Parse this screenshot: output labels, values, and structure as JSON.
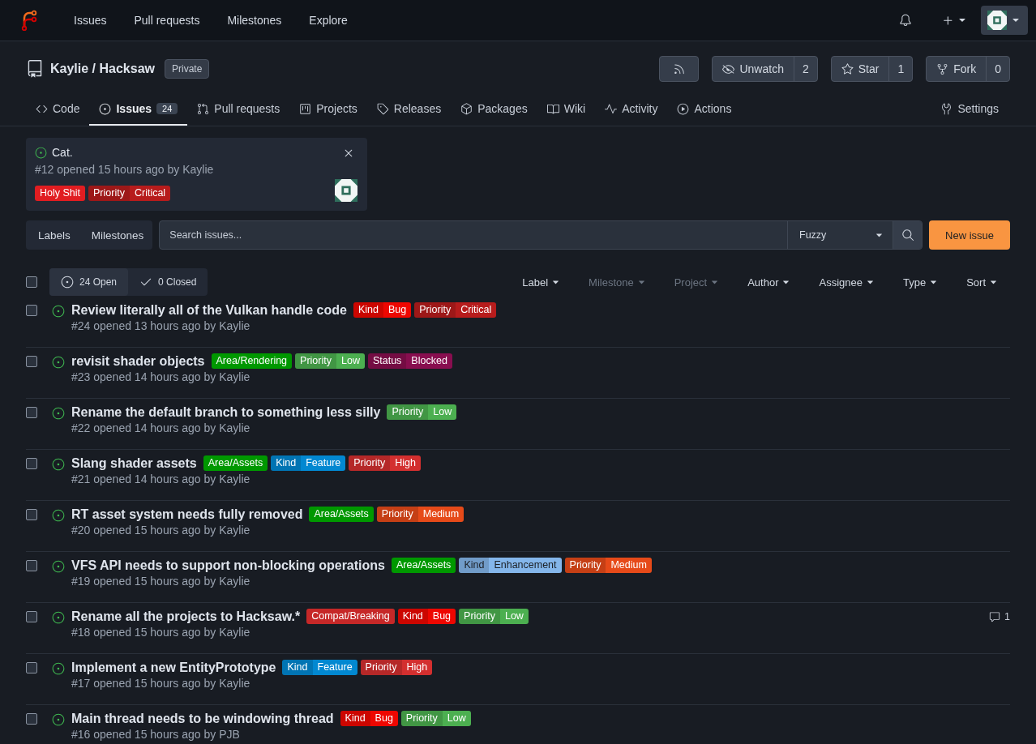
{
  "nav": {
    "links": [
      "Issues",
      "Pull requests",
      "Milestones",
      "Explore"
    ]
  },
  "repo": {
    "owner": "Kaylie",
    "separator": "/",
    "name": "Hacksaw",
    "visibility": "Private",
    "actions": [
      {
        "kind": "rss"
      },
      {
        "kind": "watch",
        "label": "Unwatch",
        "count": "2"
      },
      {
        "kind": "star",
        "label": "Star",
        "count": "1"
      },
      {
        "kind": "fork",
        "label": "Fork",
        "count": "0"
      }
    ]
  },
  "tabs": [
    {
      "label": "Code",
      "selected": false
    },
    {
      "label": "Issues",
      "count": "24",
      "selected": true
    },
    {
      "label": "Pull requests",
      "selected": false
    },
    {
      "label": "Projects",
      "selected": false
    },
    {
      "label": "Releases",
      "selected": false
    },
    {
      "label": "Packages",
      "selected": false
    },
    {
      "label": "Wiki",
      "selected": false
    },
    {
      "label": "Activity",
      "selected": false
    },
    {
      "label": "Actions",
      "selected": false
    }
  ],
  "settings_tab": {
    "label": "Settings",
    "selected": false
  },
  "pinned": {
    "title": "Cat.",
    "meta": "#12 opened 15 hours ago by Kaylie",
    "labels": [
      {
        "kind": "plain",
        "name": "Holy Shit",
        "color": "#e11d21"
      },
      {
        "kind": "scoped",
        "scope": "Priority",
        "name": "Critical",
        "color": "#b71c1c"
      }
    ]
  },
  "toolbar": {
    "links": [
      "Labels",
      "Milestones"
    ],
    "search_placeholder": "Search issues...",
    "mode": "Fuzzy",
    "new_button": "New issue"
  },
  "select_all": {
    "checked": false
  },
  "state_tabs": [
    {
      "label": "24 Open",
      "selected": true
    },
    {
      "label": "0 Closed",
      "selected": false
    }
  ],
  "filters": [
    {
      "label": "Label",
      "disabled": false
    },
    {
      "label": "Milestone",
      "disabled": true
    },
    {
      "label": "Project",
      "disabled": true
    },
    {
      "label": "Author",
      "disabled": false
    },
    {
      "label": "Assignee",
      "disabled": false
    },
    {
      "label": "Type",
      "disabled": false
    },
    {
      "label": "Sort",
      "disabled": false
    }
  ],
  "issues": [
    {
      "title": "Review literally all of the Vulkan handle code",
      "meta": "#24 opened 13 hours ago by Kaylie",
      "checked": false,
      "labels": [
        {
          "kind": "scoped",
          "scope": "Kind",
          "name": "Bug",
          "color": "#ee0701"
        },
        {
          "kind": "scoped",
          "scope": "Priority",
          "name": "Critical",
          "color": "#b71c1c"
        }
      ]
    },
    {
      "title": "revisit shader objects",
      "meta": "#23 opened 14 hours ago by Kaylie",
      "checked": false,
      "labels": [
        {
          "kind": "plain",
          "name": "Area/Rendering",
          "color": "#009800"
        },
        {
          "kind": "scoped",
          "scope": "Priority",
          "name": "Low",
          "color": "#4caf50"
        },
        {
          "kind": "scoped",
          "scope": "Status",
          "name": "Blocked",
          "color": "#880e4f"
        }
      ]
    },
    {
      "title": "Rename the default branch to something less silly",
      "meta": "#22 opened 14 hours ago by Kaylie",
      "checked": false,
      "labels": [
        {
          "kind": "scoped",
          "scope": "Priority",
          "name": "Low",
          "color": "#4caf50"
        }
      ]
    },
    {
      "title": "Slang shader assets",
      "meta": "#21 opened 14 hours ago by Kaylie",
      "checked": false,
      "labels": [
        {
          "kind": "plain",
          "name": "Area/Assets",
          "color": "#009800"
        },
        {
          "kind": "scoped",
          "scope": "Kind",
          "name": "Feature",
          "color": "#0288d1"
        },
        {
          "kind": "scoped",
          "scope": "Priority",
          "name": "High",
          "color": "#d32f2f"
        }
      ]
    },
    {
      "title": "RT asset system needs fully removed",
      "meta": "#20 opened 15 hours ago by Kaylie",
      "checked": false,
      "labels": [
        {
          "kind": "plain",
          "name": "Area/Assets",
          "color": "#009800"
        },
        {
          "kind": "scoped",
          "scope": "Priority",
          "name": "Medium",
          "color": "#e64a19"
        }
      ]
    },
    {
      "title": "VFS API needs to support non-blocking operations",
      "meta": "#19 opened 15 hours ago by Kaylie",
      "checked": false,
      "labels": [
        {
          "kind": "plain",
          "name": "Area/Assets",
          "color": "#009800"
        },
        {
          "kind": "scoped",
          "scope": "Kind",
          "name": "Enhancement",
          "color": "#84b6eb"
        },
        {
          "kind": "scoped",
          "scope": "Priority",
          "name": "Medium",
          "color": "#e64a19"
        }
      ]
    },
    {
      "title": "Rename all the projects to Hacksaw.*",
      "meta": "#18 opened 15 hours ago by Kaylie",
      "checked": false,
      "comments": "1",
      "labels": [
        {
          "kind": "plain",
          "name": "Compat/Breaking",
          "color": "#c62828"
        },
        {
          "kind": "scoped",
          "scope": "Kind",
          "name": "Bug",
          "color": "#ee0701"
        },
        {
          "kind": "scoped",
          "scope": "Priority",
          "name": "Low",
          "color": "#4caf50"
        }
      ]
    },
    {
      "title": "Implement a new EntityPrototype",
      "meta": "#17 opened 15 hours ago by Kaylie",
      "checked": false,
      "labels": [
        {
          "kind": "scoped",
          "scope": "Kind",
          "name": "Feature",
          "color": "#0288d1"
        },
        {
          "kind": "scoped",
          "scope": "Priority",
          "name": "High",
          "color": "#d32f2f"
        }
      ]
    },
    {
      "title": "Main thread needs to be windowing thread",
      "meta": "#16 opened 15 hours ago by PJB",
      "checked": false,
      "labels": [
        {
          "kind": "scoped",
          "scope": "Kind",
          "name": "Bug",
          "color": "#ee0701"
        },
        {
          "kind": "scoped",
          "scope": "Priority",
          "name": "Low",
          "color": "#4caf50"
        }
      ]
    }
  ]
}
